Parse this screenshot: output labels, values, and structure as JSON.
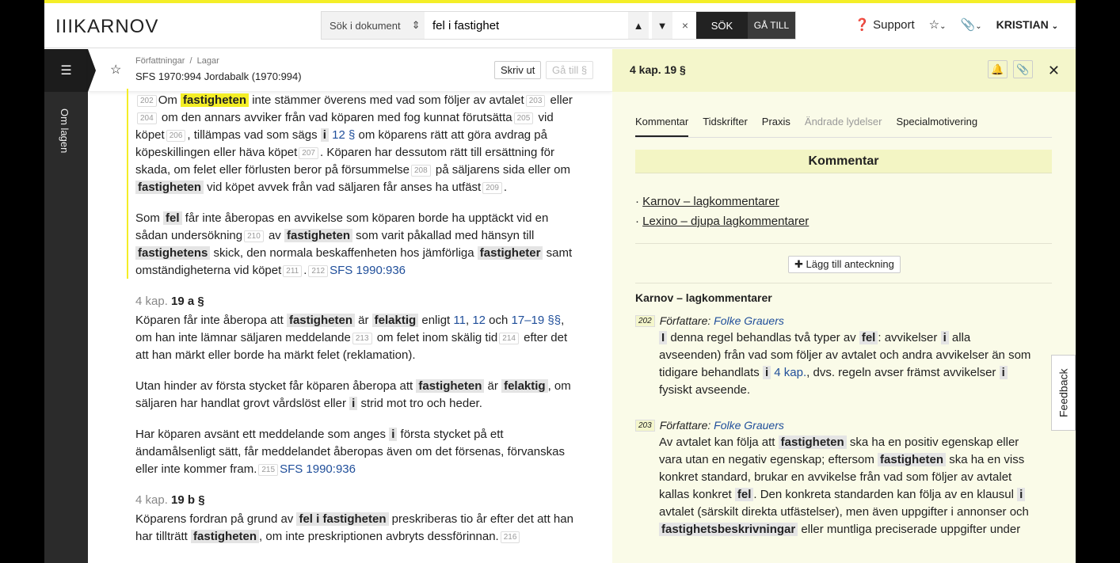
{
  "header": {
    "logo": "IIIKARNOV",
    "search_scope": "Sök i dokument",
    "search_value": "fel i fastighet",
    "up": "⌃",
    "down": "⌄",
    "clear": "×",
    "search_button": "SÖK",
    "goto_button": "GÅ TILL",
    "support": "Support",
    "user": "KRISTIAN"
  },
  "sidebar": {
    "menu_icon": "list-icon",
    "label": "Om lagen"
  },
  "doc": {
    "breadcrumb": "Författningar  /  Lagar",
    "title": "SFS 1970:994 Jordabalk (1970:994)",
    "print": "Skriv ut",
    "goto": "Gå till §",
    "blocks": [
      {
        "type": "p",
        "segs": [
          [
            "ref",
            "202"
          ],
          [
            "t",
            "Om "
          ],
          [
            "hy",
            "fastigheten"
          ],
          [
            "t",
            " inte stämmer överens med vad som följer av avtalet"
          ],
          [
            "ref",
            "203"
          ],
          [
            "t",
            " eller "
          ],
          [
            "ref",
            "204"
          ],
          [
            "t",
            " om den annars avviker från vad köparen med fog kunnat förutsätta"
          ],
          [
            "ref",
            "205"
          ],
          [
            "t",
            " vid köpet"
          ],
          [
            "ref",
            "206"
          ],
          [
            "t",
            ", tillämpas vad som sägs "
          ],
          [
            "hl",
            "i"
          ],
          [
            "t",
            " "
          ],
          [
            "link",
            "12 §"
          ],
          [
            "t",
            " om köparens rätt att göra avdrag på köpeskillingen eller häva köpet"
          ],
          [
            "ref",
            "207"
          ],
          [
            "t",
            ". Köparen har dessutom rätt till ersättning för skada, om felet eller förlusten beror på försummelse"
          ],
          [
            "ref",
            "208"
          ],
          [
            "t",
            " på säljarens sida eller om "
          ],
          [
            "hl",
            "fastigheten"
          ],
          [
            "t",
            " vid köpet avvek från vad säljaren får anses ha utfäst"
          ],
          [
            "ref",
            "209"
          ],
          [
            "t",
            "."
          ]
        ]
      },
      {
        "type": "p",
        "segs": [
          [
            "t",
            "Som "
          ],
          [
            "hl",
            "fel"
          ],
          [
            "t",
            " får inte åberopas en avvikelse som köparen borde ha upptäckt vid en sådan undersökning"
          ],
          [
            "ref",
            "210"
          ],
          [
            "t",
            " av "
          ],
          [
            "hl",
            "fastigheten"
          ],
          [
            "t",
            " som varit påkallad med hänsyn till "
          ],
          [
            "hl",
            "fastighetens"
          ],
          [
            "t",
            " skick, den normala beskaffenheten hos jämförliga "
          ],
          [
            "hl",
            "fastigheter"
          ],
          [
            "t",
            " samt omständigheterna vid köpet"
          ],
          [
            "ref",
            "211"
          ],
          [
            "t",
            "."
          ],
          [
            "ref",
            "212"
          ],
          [
            "link",
            "SFS 1990:936"
          ]
        ]
      },
      {
        "type": "sec",
        "k": "4 kap.",
        "n": "19 a §"
      },
      {
        "type": "p",
        "segs": [
          [
            "t",
            "Köparen får inte åberopa att "
          ],
          [
            "hl",
            "fastigheten"
          ],
          [
            "t",
            " är "
          ],
          [
            "hl",
            "felaktig"
          ],
          [
            "t",
            " enligt "
          ],
          [
            "link",
            "11"
          ],
          [
            "t",
            ", "
          ],
          [
            "link",
            "12"
          ],
          [
            "t",
            " och "
          ],
          [
            "link",
            "17–19 §§"
          ],
          [
            "t",
            ", om han inte lämnar säljaren meddelande"
          ],
          [
            "ref",
            "213"
          ],
          [
            "t",
            " om felet inom skälig tid"
          ],
          [
            "ref",
            "214"
          ],
          [
            "t",
            " efter det att han märkt eller borde ha märkt felet (reklamation)."
          ]
        ]
      },
      {
        "type": "p",
        "segs": [
          [
            "t",
            "Utan hinder av första stycket får köparen åberopa att "
          ],
          [
            "hl",
            "fastigheten"
          ],
          [
            "t",
            " är "
          ],
          [
            "hl",
            "felaktig"
          ],
          [
            "t",
            ", om säljaren har handlat grovt vårdslöst eller "
          ],
          [
            "hl",
            "i"
          ],
          [
            "t",
            " strid mot tro och heder."
          ]
        ]
      },
      {
        "type": "p",
        "segs": [
          [
            "t",
            "Har köparen avsänt ett meddelande som anges "
          ],
          [
            "hl",
            "i"
          ],
          [
            "t",
            " första stycket på ett ändamålsenligt sätt, får meddelandet åberopas även om det försenas, förvanskas eller inte kommer fram."
          ],
          [
            "ref",
            "215"
          ],
          [
            "link",
            "SFS 1990:936"
          ]
        ]
      },
      {
        "type": "sec",
        "k": "4 kap.",
        "n": "19 b §"
      },
      {
        "type": "p",
        "segs": [
          [
            "t",
            "Köparens fordran på grund av "
          ],
          [
            "hl",
            "fel i fastigheten"
          ],
          [
            "t",
            " preskriberas tio år efter det att han har tillträtt "
          ],
          [
            "hl",
            "fastigheten"
          ],
          [
            "t",
            ", om inte preskriptionen avbryts dessförinnan."
          ],
          [
            "ref",
            "216"
          ]
        ]
      }
    ]
  },
  "panel": {
    "title": "4 kap. 19 §",
    "tabs": [
      "Kommentar",
      "Tidskrifter",
      "Praxis",
      "Ändrade lydelser",
      "Specialmotivering"
    ],
    "active_tab": 0,
    "section_title": "Kommentar",
    "links": [
      "Karnov – lagkommentarer",
      "Lexino – djupa lagkommentarer"
    ],
    "add_note": "Lägg till anteckning",
    "comments_heading": "Karnov – lagkommentarer",
    "comments": [
      {
        "num": "202",
        "author_label": "Författare: ",
        "author": "Folke Grauers",
        "segs": [
          [
            "hl",
            "I"
          ],
          [
            "t",
            " denna regel behandlas två typer av "
          ],
          [
            "hl",
            "fel"
          ],
          [
            "t",
            ": avvikelser "
          ],
          [
            "hl",
            "i"
          ],
          [
            "t",
            " alla avseenden) från vad som följer av avtalet och andra avvikelser än som tidigare behandlats "
          ],
          [
            "hl",
            "i"
          ],
          [
            "t",
            " "
          ],
          [
            "link",
            "4 kap."
          ],
          [
            "t",
            ", dvs. regeln avser främst avvikelser "
          ],
          [
            "hl",
            "i"
          ],
          [
            "t",
            " fysiskt avseende."
          ]
        ]
      },
      {
        "num": "203",
        "author_label": "Författare: ",
        "author": "Folke Grauers",
        "segs": [
          [
            "t",
            "Av avtalet kan följa att "
          ],
          [
            "hl",
            "fastigheten"
          ],
          [
            "t",
            " ska ha en positiv egenskap eller vara utan en negativ egenskap; eftersom "
          ],
          [
            "hl",
            "fastigheten"
          ],
          [
            "t",
            " ska ha en viss konkret standard, brukar en avvikelse från vad som följer av avtalet kallas konkret "
          ],
          [
            "hl",
            "fel"
          ],
          [
            "t",
            ". Den konkreta standarden kan följa av en klausul "
          ],
          [
            "hl",
            "i"
          ],
          [
            "t",
            " avtalet (särskilt direkta utfästelser), men även uppgifter i annonser och "
          ],
          [
            "hl",
            "fastighetsbeskrivningar"
          ],
          [
            "t",
            " eller muntliga preciserade uppgifter under"
          ]
        ]
      }
    ],
    "feedback": "Feedback"
  },
  "colors": {
    "accent_yellow": "#f4ee27",
    "panel_bg": "#fafbe8",
    "link": "#1f4e9a"
  }
}
